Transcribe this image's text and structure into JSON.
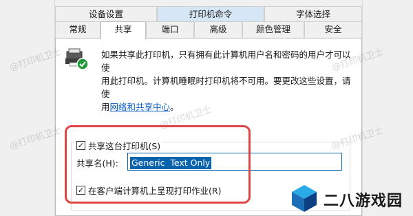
{
  "tabs_top": [
    "设备设置",
    "打印机命令",
    "字体选择"
  ],
  "tabs_bottom": [
    "常规",
    "共享",
    "端口",
    "高级",
    "颜色管理",
    "安全"
  ],
  "active_tab": "共享",
  "info": {
    "line1": "如果共享此打印机，只有拥有此计算机用户名和密码的用户才可以使",
    "line2": "用此打印机。计算机睡眠时打印机将不可用。要更改这些设置，请使",
    "line3_prefix": "用",
    "link": "网络和共享中心",
    "line3_suffix": "。"
  },
  "share_checkbox": {
    "label": "共享这台打印机(S)",
    "checked": true
  },
  "share_name": {
    "label": "共享名(H):",
    "value": "Generic  Text Only"
  },
  "render_checkbox": {
    "label": "在客户端计算机上呈现打印作业(R)",
    "checked": true
  },
  "watermark": "@打印机卫士",
  "brand": {
    "name": "二八游戏园"
  },
  "colors": {
    "accent": "#0a64ad",
    "highlight_box": "#e04545",
    "link": "#0b5fc4"
  }
}
